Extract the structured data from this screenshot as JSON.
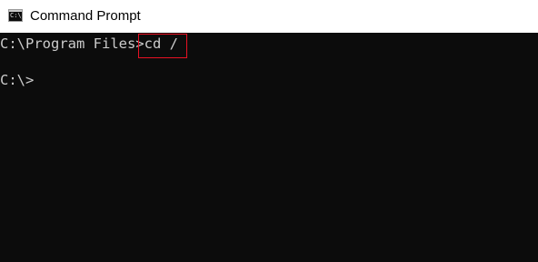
{
  "window": {
    "title": "Command Prompt",
    "icon": "cmd-icon",
    "icon_glyph": "C:\\_"
  },
  "console": {
    "lines": [
      {
        "prompt": "C:\\Program Files>",
        "command": "cd /"
      },
      {
        "prompt": "C:\\>",
        "command": ""
      }
    ]
  },
  "colors": {
    "console_background": "#0c0c0c",
    "console_text": "#cccccc",
    "titlebar_background": "#ffffff",
    "highlight_border": "#e81123"
  }
}
